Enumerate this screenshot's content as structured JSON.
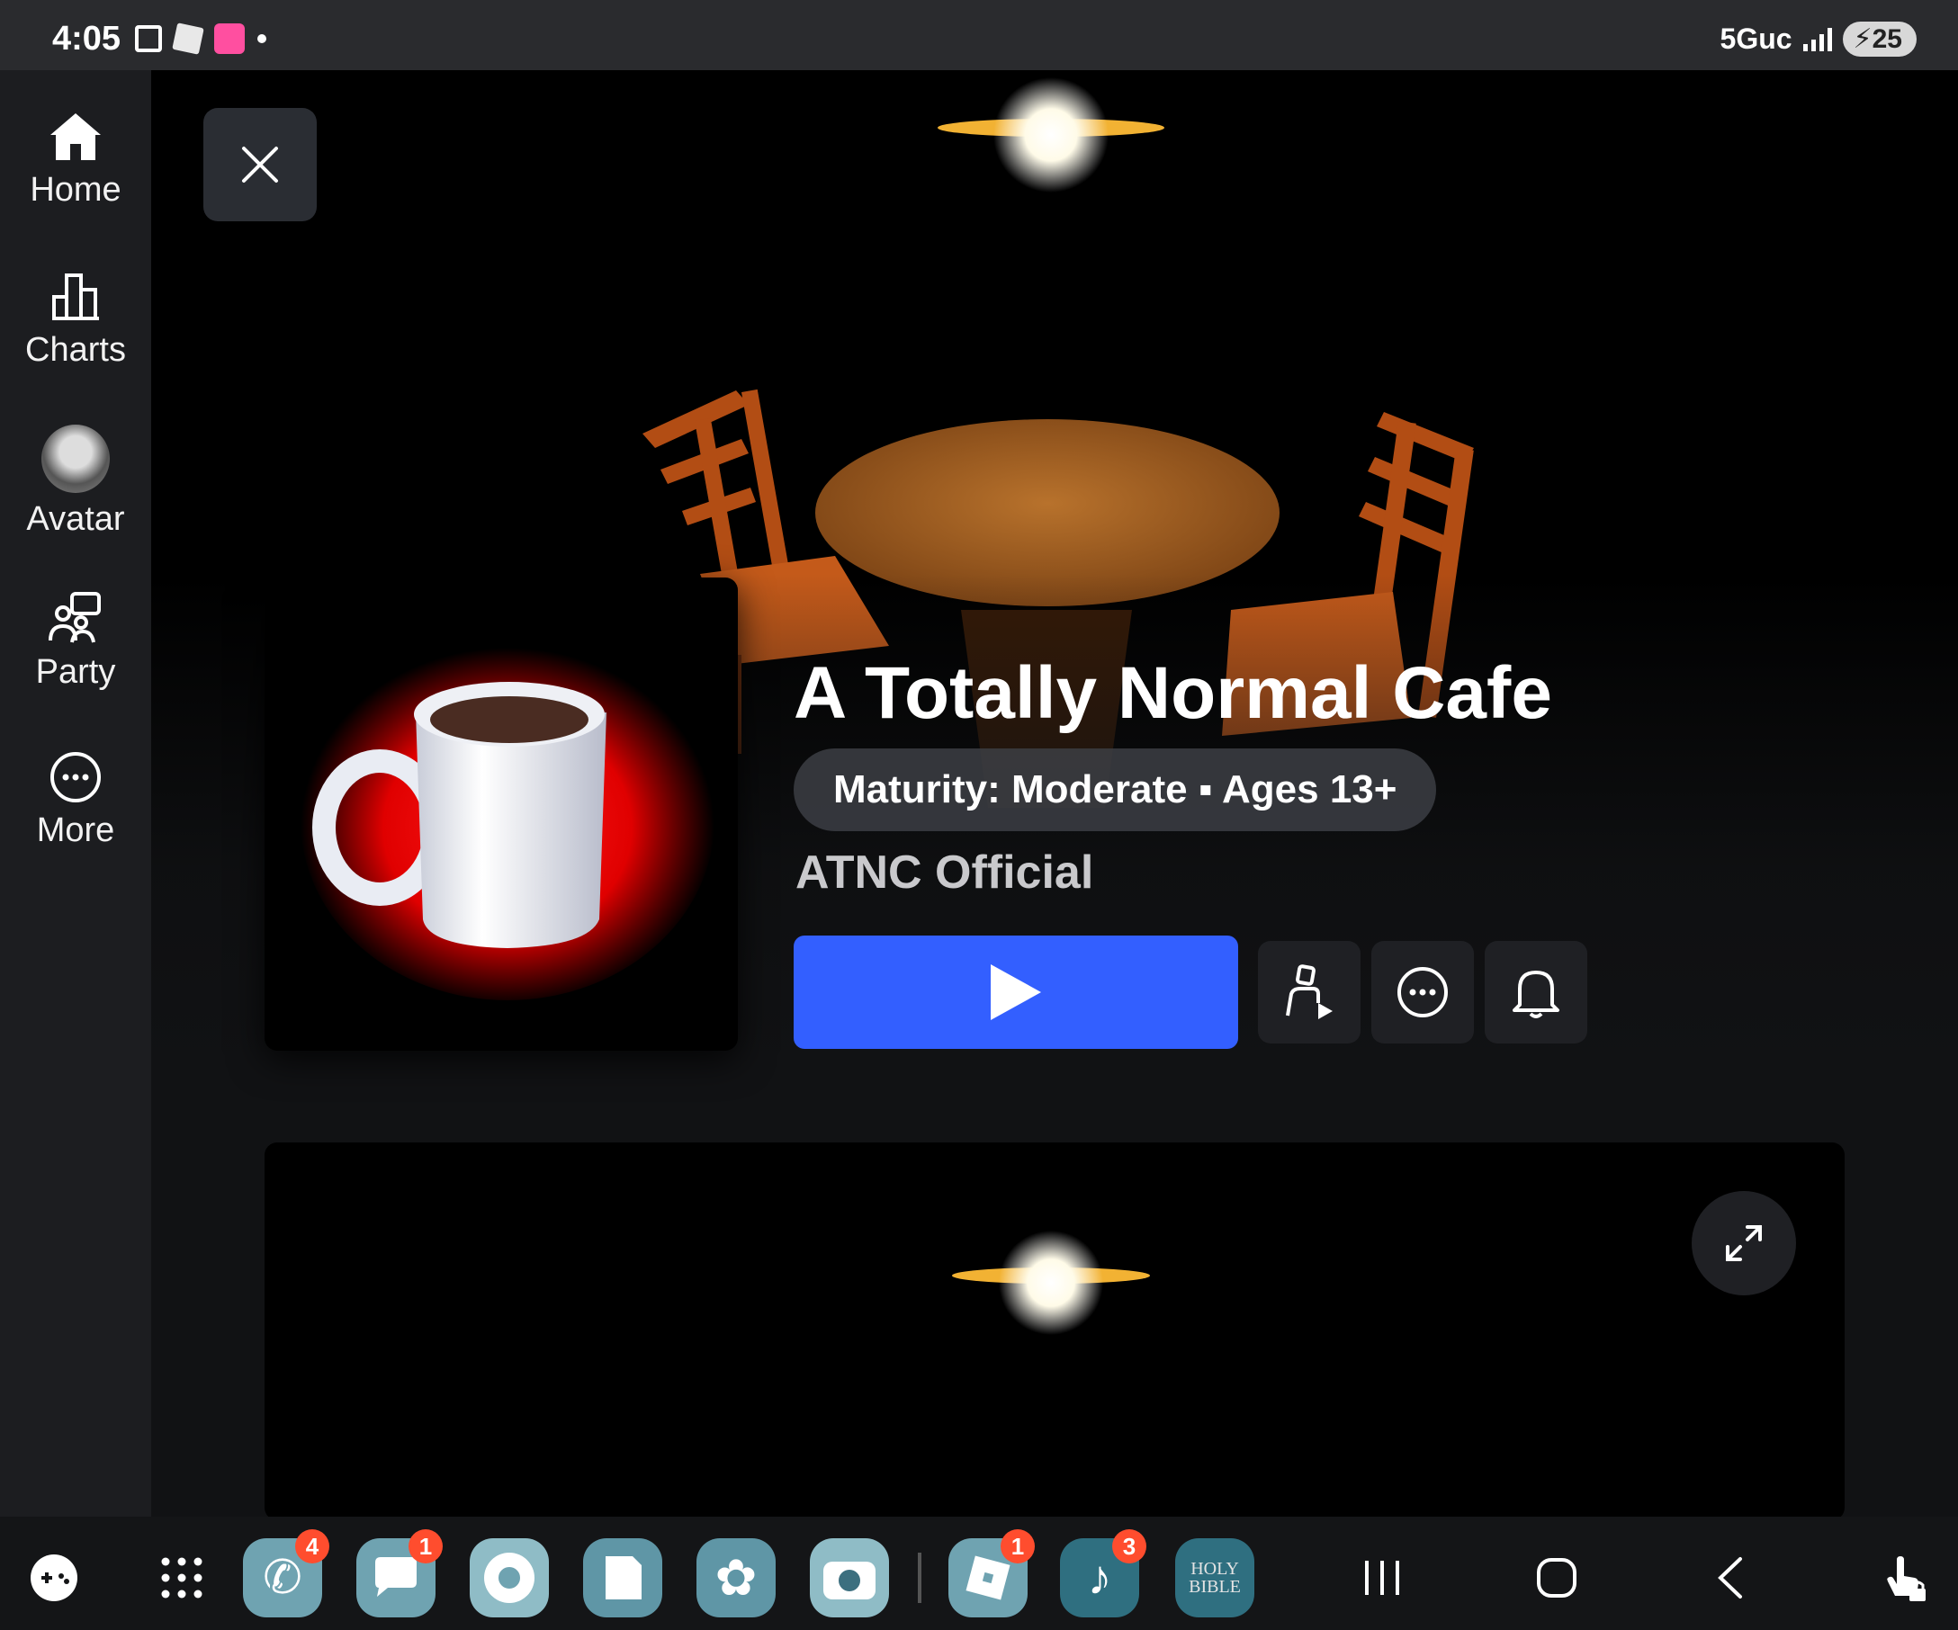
{
  "status_bar": {
    "time": "4:05",
    "network": "5Guc",
    "battery": "25"
  },
  "sidebar": {
    "items": [
      {
        "label": "Home",
        "icon": "home-icon"
      },
      {
        "label": "Charts",
        "icon": "charts-icon"
      },
      {
        "label": "Avatar",
        "icon": "avatar-icon"
      },
      {
        "label": "Party",
        "icon": "party-icon"
      },
      {
        "label": "More",
        "icon": "more-icon"
      }
    ]
  },
  "experience": {
    "title": "A Totally Normal Cafe",
    "maturity": "Maturity: Moderate ▪ Ages 13+",
    "creator": "ATNC Official"
  },
  "actions": {
    "play": "play-icon",
    "buttons": [
      "play-with-friends-icon",
      "more-options-icon",
      "notify-bell-icon"
    ]
  },
  "taskbar": {
    "apps": [
      {
        "name": "game-launcher-icon",
        "badge": ""
      },
      {
        "name": "app-drawer-icon",
        "badge": ""
      },
      {
        "name": "phone-app-icon",
        "badge": "4"
      },
      {
        "name": "messages-app-icon",
        "badge": "1"
      },
      {
        "name": "chrome-app-icon",
        "badge": ""
      },
      {
        "name": "notes-app-icon",
        "badge": ""
      },
      {
        "name": "bixby-app-icon",
        "badge": ""
      },
      {
        "name": "camera-app-icon",
        "badge": ""
      },
      {
        "name": "roblox-app-icon",
        "badge": "1"
      },
      {
        "name": "tiktok-app-icon",
        "badge": "3"
      },
      {
        "name": "bible-app-icon",
        "badge": ""
      }
    ],
    "bible_text": "HOLY BIBLE"
  },
  "colors": {
    "play_blue": "#335fff",
    "badge_red": "#ff4d2e",
    "sidebar_bg": "#1c1d20"
  }
}
